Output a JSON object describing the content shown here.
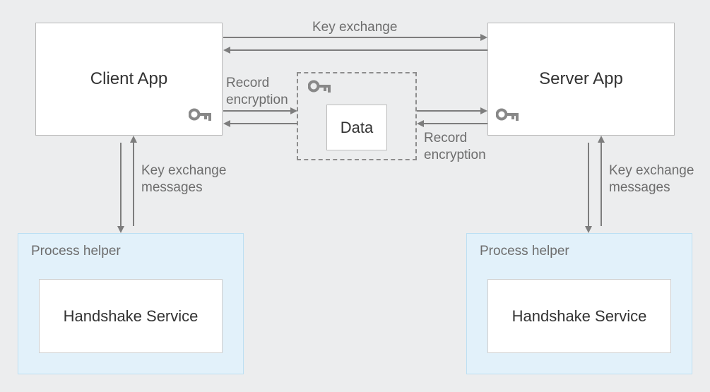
{
  "nodes": {
    "client_app": "Client App",
    "server_app": "Server App",
    "data": "Data",
    "process_helper_left": "Process helper",
    "process_helper_right": "Process helper",
    "handshake_left": "Handshake Service",
    "handshake_right": "Handshake Service"
  },
  "labels": {
    "key_exchange": "Key exchange",
    "record_encryption_left": "Record\nencryption",
    "record_encryption_right": "Record\nencryption",
    "key_exchange_msgs_left": "Key exchange\nmessages",
    "key_exchange_msgs_right": "Key exchange\nmessages"
  },
  "icons": {
    "key": "key-icon"
  }
}
